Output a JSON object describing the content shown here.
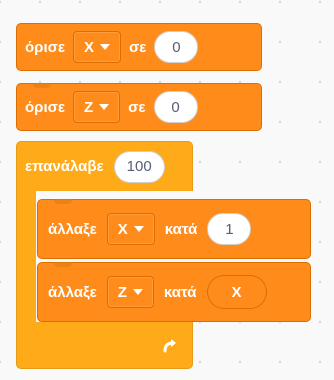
{
  "blocks": {
    "set_x": {
      "keyword": "όρισε",
      "variable": "X",
      "to": "σε",
      "value": "0"
    },
    "set_z": {
      "keyword": "όρισε",
      "variable": "Z",
      "to": "σε",
      "value": "0"
    },
    "repeat": {
      "keyword": "επανάλαβε",
      "count": "100"
    },
    "change_x": {
      "keyword": "άλλαξε",
      "variable": "X",
      "by": "κατά",
      "value": "1"
    },
    "change_z": {
      "keyword": "άλλαξε",
      "variable": "Z",
      "by": "κατά",
      "reporter": "X"
    }
  },
  "colors": {
    "variables": "#ff8c1a",
    "control": "#ffab19",
    "workspace": "#f9f9f9"
  },
  "icons": {
    "loop_arrow": "loop-arrow-icon"
  }
}
